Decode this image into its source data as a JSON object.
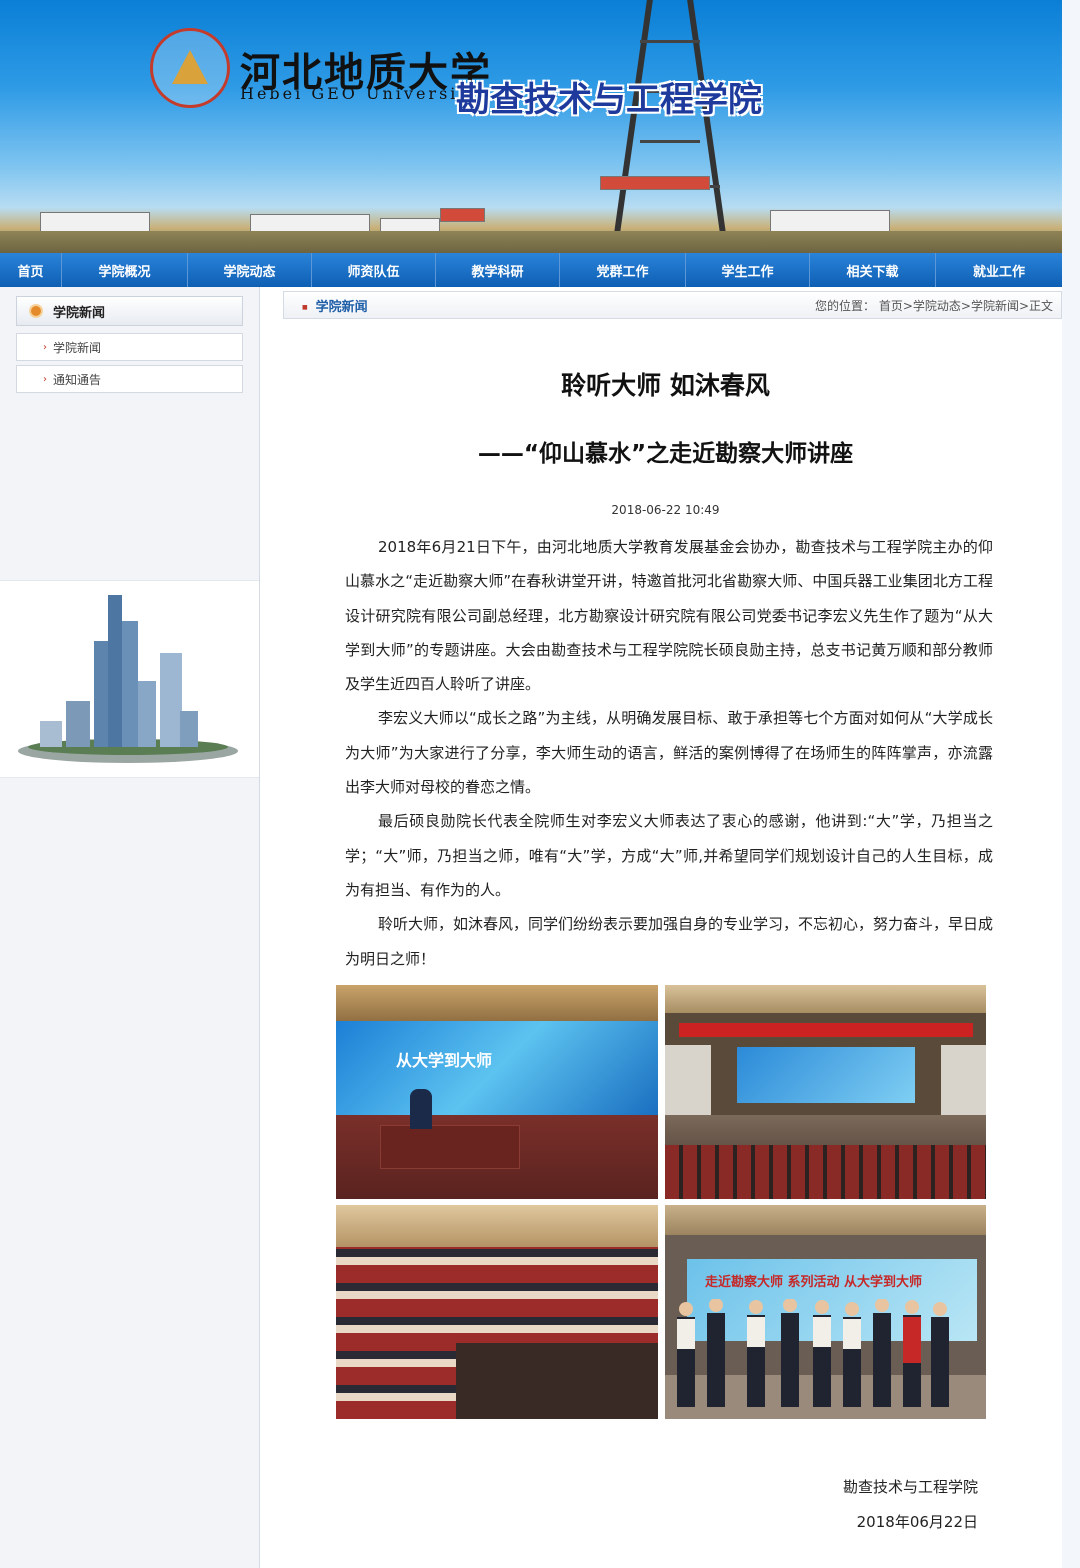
{
  "header": {
    "university_cn": "河北地质大学",
    "university_en": "Hebei GEO University",
    "college_name": "勘查技术与工程学院"
  },
  "nav": {
    "items": [
      "首页",
      "学院概况",
      "学院动态",
      "师资队伍",
      "教学科研",
      "党群工作",
      "学生工作",
      "相关下载",
      "就业工作"
    ]
  },
  "sidebar": {
    "heading": "学院新闻",
    "links": [
      "学院新闻",
      "通知通告"
    ]
  },
  "breadcrumb": {
    "section": "学院新闻",
    "location": "您的位置： 首页>学院动态>学院新闻>正文"
  },
  "article": {
    "title": "聆听大师  如沐春风",
    "subtitle": "——“仰山慕水”之走近勘察大师讲座",
    "date": "2018-06-22 10:49",
    "paragraphs": [
      "2018年6月21日下午，由河北地质大学教育发展基金会协办，勘查技术与工程学院主办的仰山慕水之“走近勘察大师”在春秋讲堂开讲，特邀首批河北省勘察大师、中国兵器工业集团北方工程设计研究院有限公司副总经理，北方勘察设计研究院有限公司党委书记李宏义先生作了题为“从大学到大师”的专题讲座。大会由勘查技术与工程学院院长硕良勋主持，总支书记黄万顺和部分教师及学生近四百人聆听了讲座。",
      "李宏义大师以“成长之路”为主线，从明确发展目标、敢于承担等七个方面对如何从“大学成长为大师”为大家进行了分享，李大师生动的语言，鲜活的案例博得了在场师生的阵阵掌声，亦流露出李大师对母校的眷恋之情。",
      "最后硕良勋院长代表全院师生对李宏义大师表达了衷心的感谢，他讲到:“大”学，乃担当之学；“大”师，乃担当之师，唯有“大”学，方成“大”师,并希望同学们规划设计自己的人生目标，成为有担当、有作为的人。",
      "聆听大师，如沐春风，同学们纷纷表示要加强自身的专业学习，不忘初心，努力奋斗，早日成为明日之师！"
    ],
    "photo_captions": [
      "从大学到大师",
      "走近勘察大师 系列活动 从大学到大师"
    ],
    "sign_org": "勘查技术与工程学院",
    "sign_date": "2018年06月22日"
  },
  "colors": {
    "nav_blue": "#0e5fb3",
    "banner_sky": "#2f9be6",
    "accent_red": "#c0392b",
    "section_blue": "#1f5fa8"
  }
}
